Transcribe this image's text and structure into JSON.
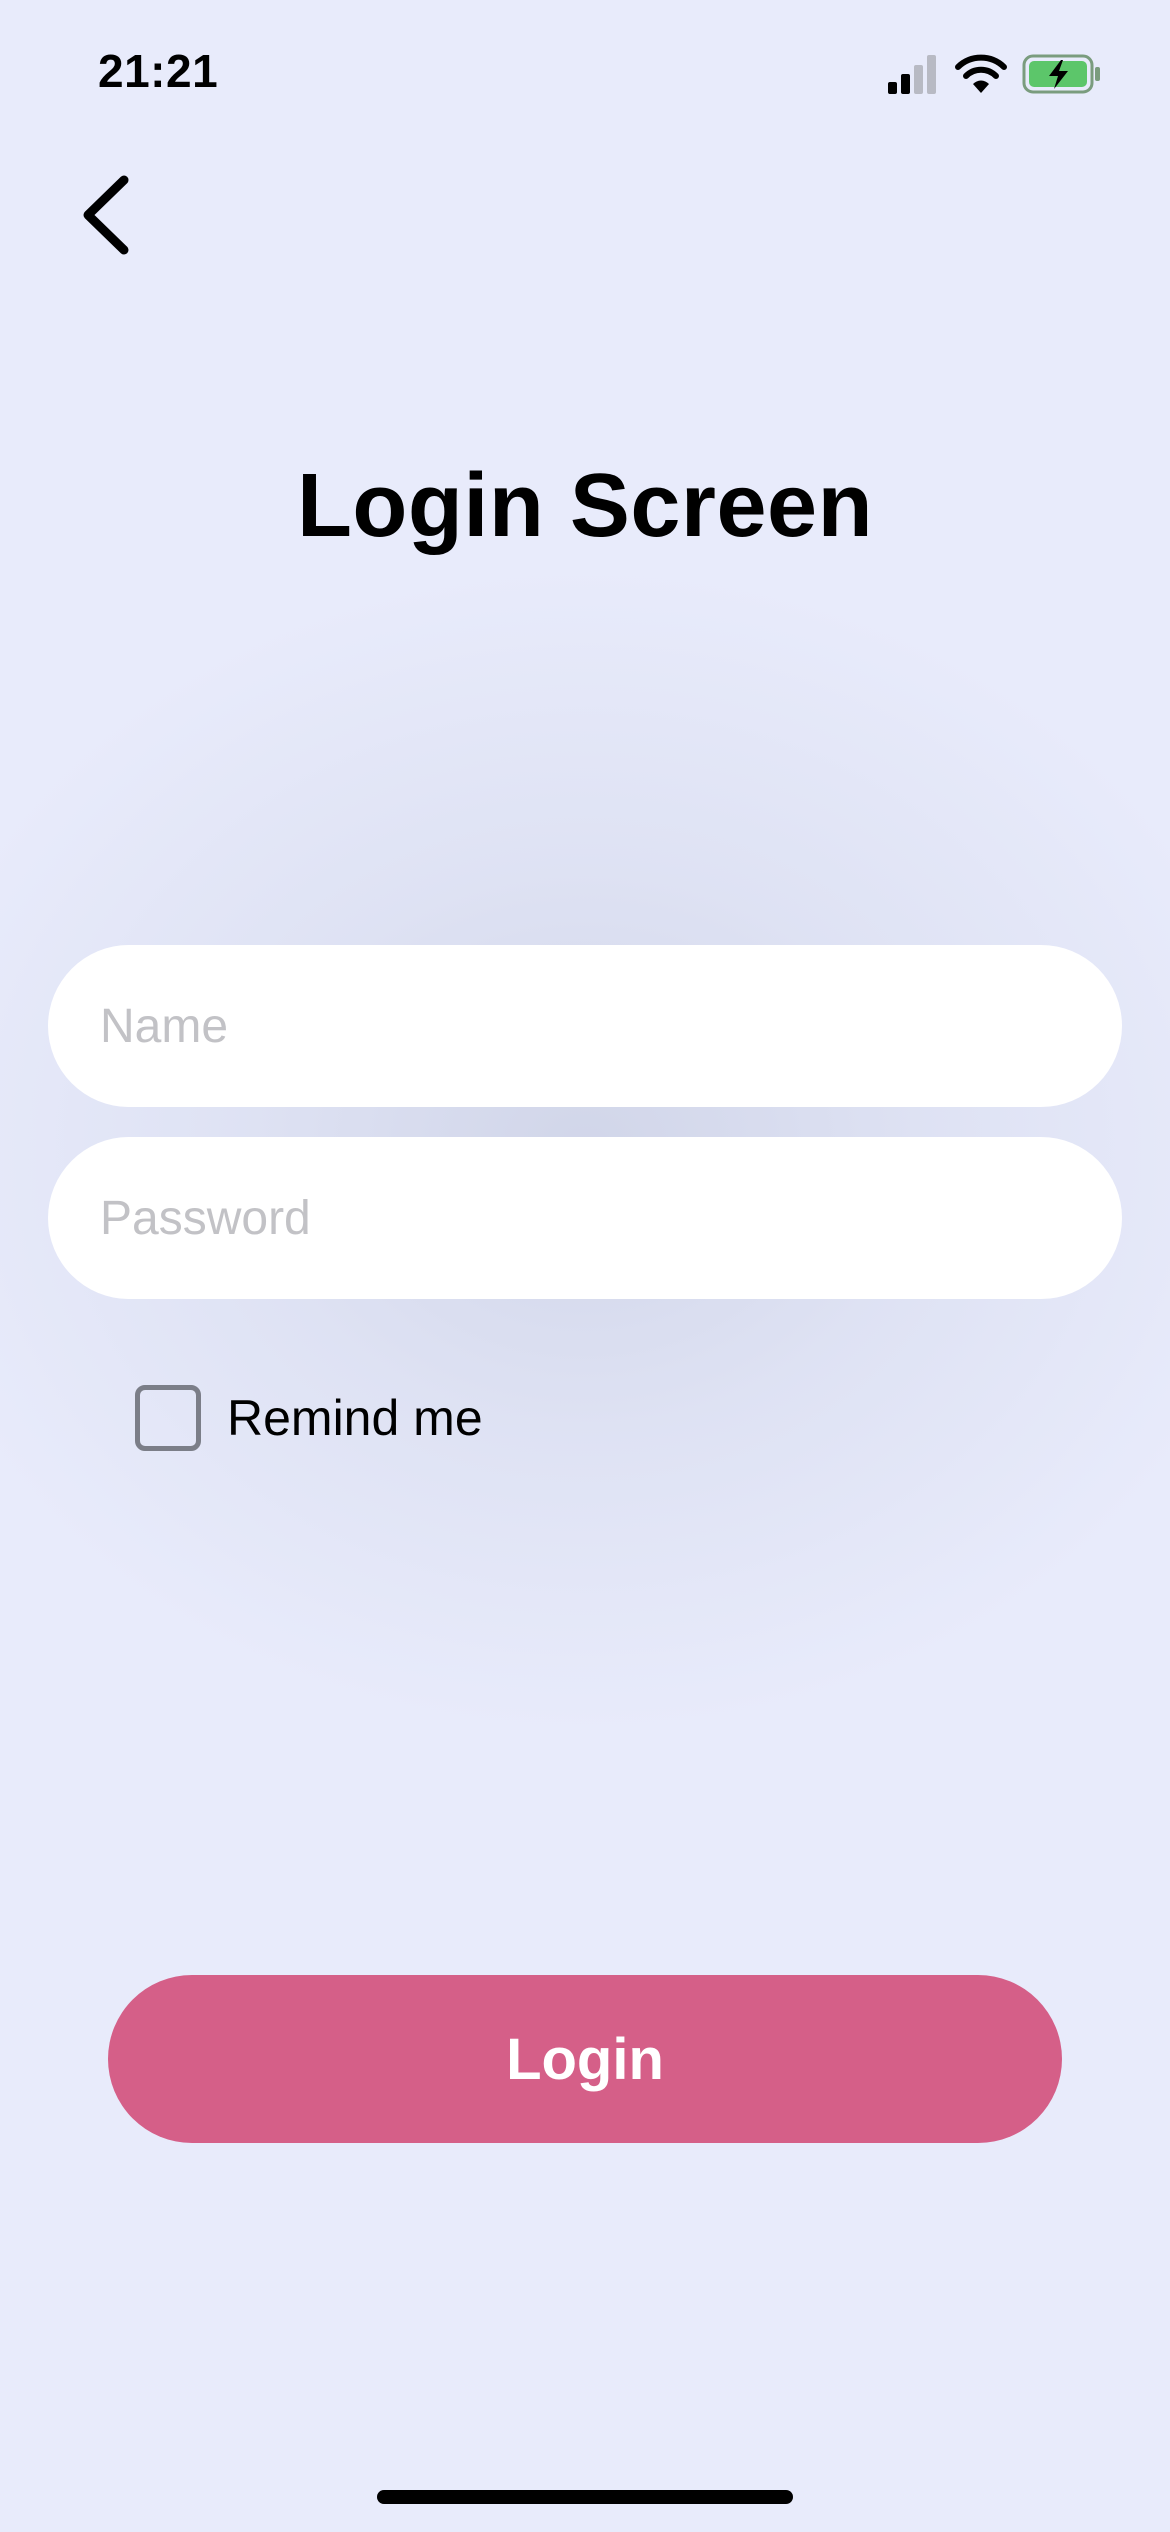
{
  "status_bar": {
    "time": "21:21"
  },
  "nav": {
    "back_icon": "chevron-left-icon"
  },
  "header": {
    "title": "Login Screen"
  },
  "form": {
    "name_placeholder": "Name",
    "name_value": "",
    "password_placeholder": "Password",
    "password_value": "",
    "remember_label": "Remind me",
    "remember_checked": false,
    "login_label": "Login"
  },
  "colors": {
    "background": "#E8EBFB",
    "accent": "#D55F88",
    "battery_fill": "#5CC66A"
  }
}
